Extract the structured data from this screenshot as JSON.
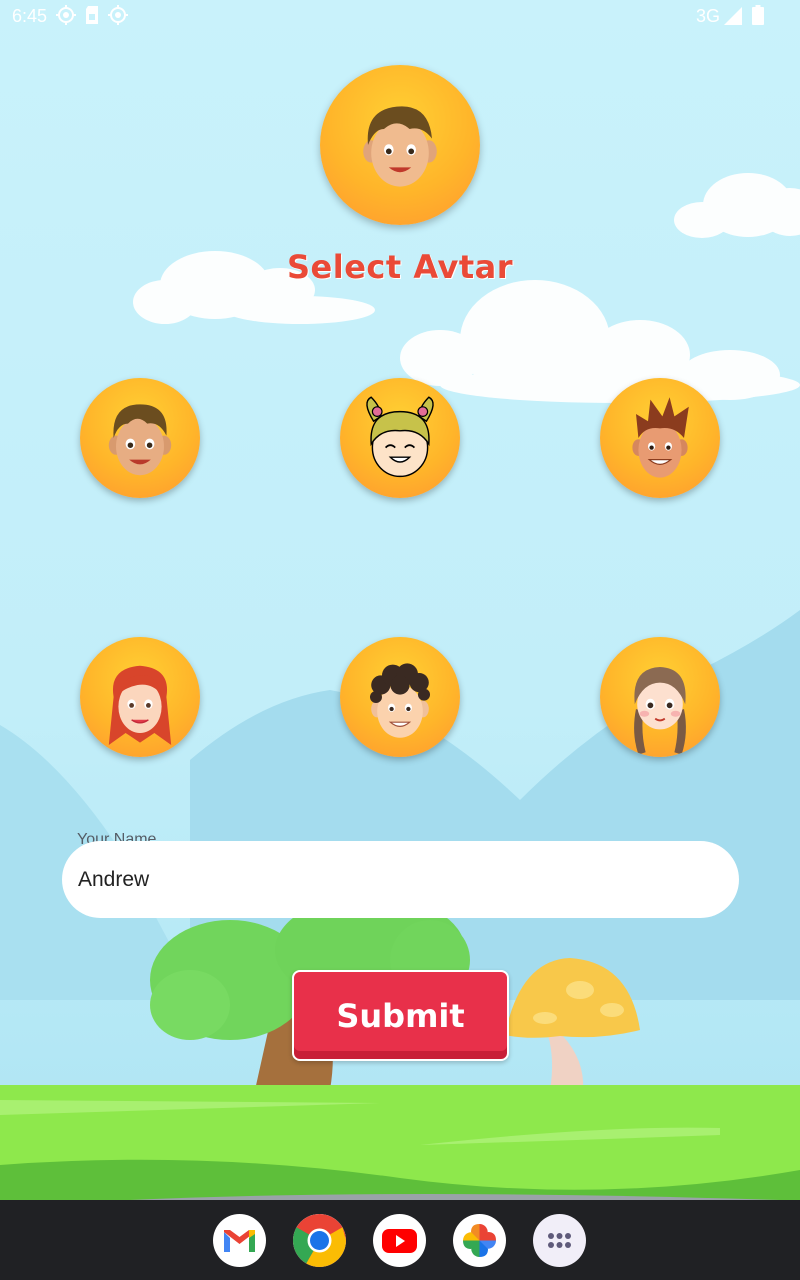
{
  "status_bar": {
    "time": "6:45",
    "network": "3G",
    "left_icons": [
      "location-target-icon",
      "sim-card-icon",
      "location-target-icon"
    ],
    "right_icons": [
      "signal-icon",
      "battery-icon"
    ]
  },
  "page": {
    "title": "Select Avtar",
    "selected_avatar": "boy-brown-hair-1"
  },
  "avatars": [
    {
      "name": "boy-brown-hair-1"
    },
    {
      "name": "girl-pigtails"
    },
    {
      "name": "boy-spiky-hair"
    },
    {
      "name": "girl-red-hair"
    },
    {
      "name": "boy-curly-hair"
    },
    {
      "name": "girl-braids"
    }
  ],
  "form": {
    "name_label": "Your Name",
    "name_value": "Andrew",
    "submit_label": "Submit"
  },
  "dock": {
    "apps": [
      "gmail-icon",
      "chrome-icon",
      "youtube-icon",
      "photos-icon",
      "app-drawer-icon"
    ]
  },
  "colors": {
    "title": "#ea4a37",
    "submit": "#e8304a",
    "avatar_bg": "#ffb52a",
    "sky": "#c9f2fb",
    "grass": "#8ee84c"
  }
}
